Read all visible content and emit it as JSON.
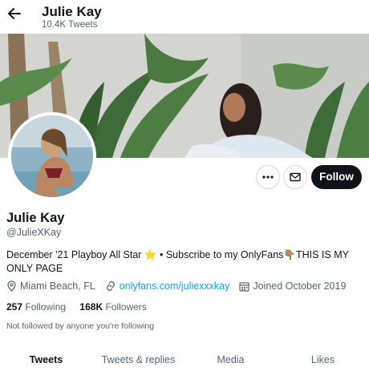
{
  "header": {
    "name": "Julie Kay",
    "tweet_count": "10.4K Tweets"
  },
  "icons": {
    "back": "arrow-left-icon",
    "more": "more-horizontal-icon",
    "message": "envelope-icon",
    "location": "location-pin-icon",
    "link": "link-icon",
    "calendar": "calendar-icon"
  },
  "actions": {
    "follow_label": "Follow"
  },
  "profile": {
    "name": "Julie Kay",
    "handle": "@JulieXKay",
    "bio_part1": "December '21 Playboy All Star ",
    "bio_emoji1": "⭐",
    "bio_part2": " • Subscribe to my OnlyFans",
    "bio_emoji2": "👇🏽",
    "bio_part3": "THIS IS MY ONLY PAGE",
    "location": "Miami Beach, FL",
    "website": "onlyfans.com/juliexxxkay",
    "joined": "Joined October 2019"
  },
  "stats": {
    "following_count": "257",
    "following_label": "Following",
    "followers_count": "168K",
    "followers_label": "Followers"
  },
  "social_context": "Not followed by anyone you're following",
  "tabs": [
    "Tweets",
    "Tweets & replies",
    "Media",
    "Likes"
  ],
  "colors": {
    "text": "#0f1419",
    "secondary": "#536471",
    "link": "#1d9bf0",
    "follow_button": "#0f1419"
  }
}
